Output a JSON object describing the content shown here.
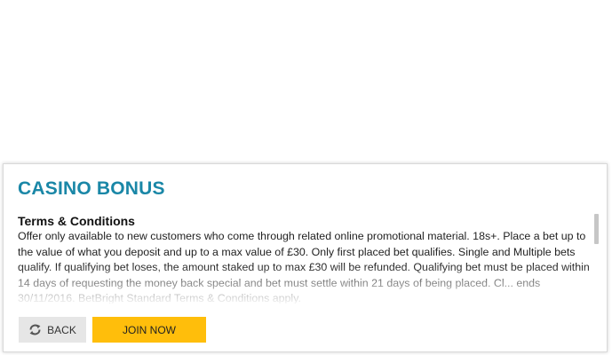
{
  "panel": {
    "title": "CASINO BONUS",
    "terms_heading": "Terms & Conditions",
    "terms_body": "Offer only available to new customers who come through related online promotional material. 18s+. Place a bet up to the value of what you deposit and up to a max value of £30. Only first placed bet qualifies. Single and Multiple bets qualify. If qualifying bet loses, the amount staked up to max £30 will be refunded. Qualifying bet must be placed within 14 days of requesting the money back special and bet must settle within 21 days of being placed. Cl... ends 30/11/2016. BetBright Standard Terms & Conditions apply.",
    "back_label": "BACK",
    "back_icon": "refresh-icon",
    "join_label": "JOIN NOW"
  },
  "colors": {
    "title": "#1a87a7",
    "join_button": "#ffbe0b",
    "back_button": "#e6e6e6"
  }
}
